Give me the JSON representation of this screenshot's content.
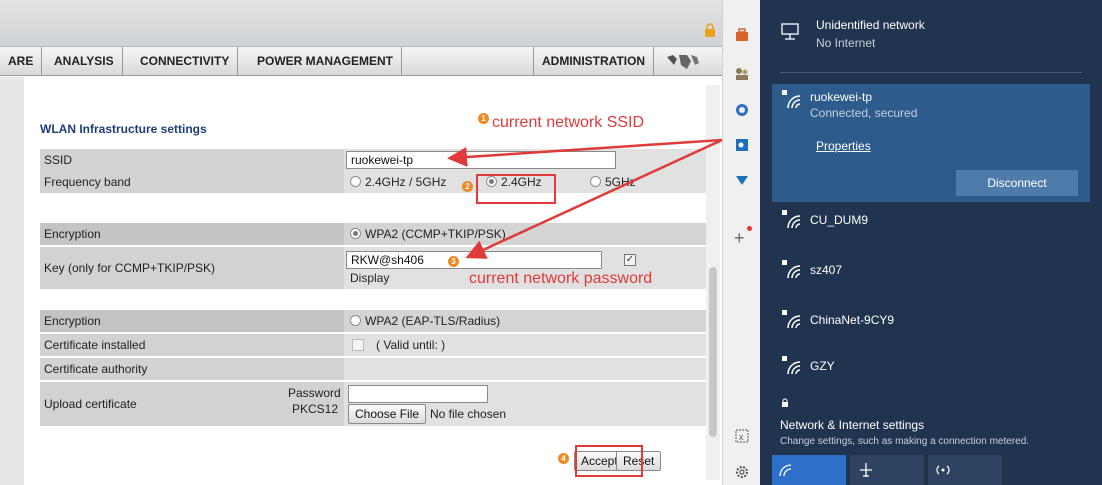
{
  "browser": {
    "navbar": {
      "items": [
        "ARE",
        "ANALYSIS",
        "CONNECTIVITY",
        "POWER MANAGEMENT",
        "ADMINISTRATION"
      ]
    },
    "section_title": "WLAN Infrastructure settings",
    "ssid": {
      "label": "SSID",
      "value": "ruokewei-tp"
    },
    "frequency": {
      "label": "Frequency band",
      "options": [
        "2.4GHz / 5GHz",
        "2.4GHz",
        "5GHz"
      ],
      "selected": "2.4GHz"
    },
    "encryption1": {
      "label": "Encryption",
      "option": "WPA2 (CCMP+TKIP/PSK)"
    },
    "key": {
      "label": "Key (only for CCMP+TKIP/PSK)",
      "value": "RKW@sh406",
      "display_label": "Display"
    },
    "encryption2": {
      "label": "Encryption",
      "option": "WPA2 (EAP-TLS/Radius)"
    },
    "certificate_installed": {
      "label": "Certificate installed",
      "valid_text": "( Valid until: )"
    },
    "certificate_authority": {
      "label": "Certificate authority"
    },
    "upload": {
      "label": "Upload certificate",
      "sub_label_1": "Password",
      "sub_label_2": "PKCS12",
      "choose_file": "Choose File",
      "no_file": "No file chosen"
    },
    "buttons": {
      "accept": "Accept",
      "reset": "Reset"
    }
  },
  "annotations": {
    "a1_num": "1",
    "a1_text": "current network SSID",
    "a2_num": "2",
    "a3_num": "3",
    "a3_text": "current network password",
    "a4_num": "4"
  },
  "flyout": {
    "unidentified": {
      "name": "Unidentified network",
      "status": "No Internet"
    },
    "active": {
      "name": "ruokewei-tp",
      "status": "Connected, secured",
      "properties": "Properties",
      "disconnect": "Disconnect"
    },
    "networks": [
      "CU_DUM9",
      "sz407",
      "ChinaNet-9CY9",
      "GZY"
    ],
    "settings_title": "Network & Internet settings",
    "settings_desc": "Change settings, such as making a connection metered."
  },
  "colors": {
    "annotation_red": "#e03a3a",
    "badge_orange": "#f08a24",
    "flyout_bg": "#20344f",
    "active_bg": "#2c5b8c"
  }
}
